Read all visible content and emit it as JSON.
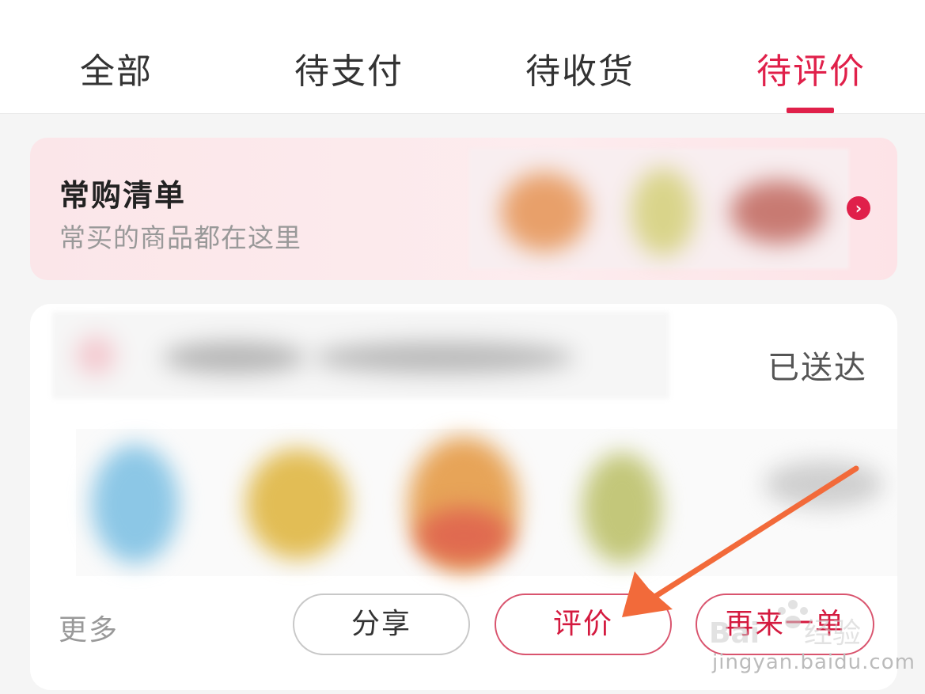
{
  "tabs": [
    {
      "label": "全部",
      "active": false
    },
    {
      "label": "待支付",
      "active": false
    },
    {
      "label": "待收货",
      "active": false
    },
    {
      "label": "待评价",
      "active": true
    }
  ],
  "banner": {
    "title": "常购清单",
    "subtitle": "常买的商品都在这里",
    "arrow_icon": "chevron-right-icon"
  },
  "order": {
    "status": "已送达",
    "more_label": "更多",
    "buttons": {
      "share": "分享",
      "review": "评价",
      "reorder": "再来一单"
    }
  },
  "watermark": {
    "text": "jingyan.baidu.com"
  },
  "colors": {
    "accent": "#e0204a",
    "annotation_arrow": "#f26a3a"
  }
}
